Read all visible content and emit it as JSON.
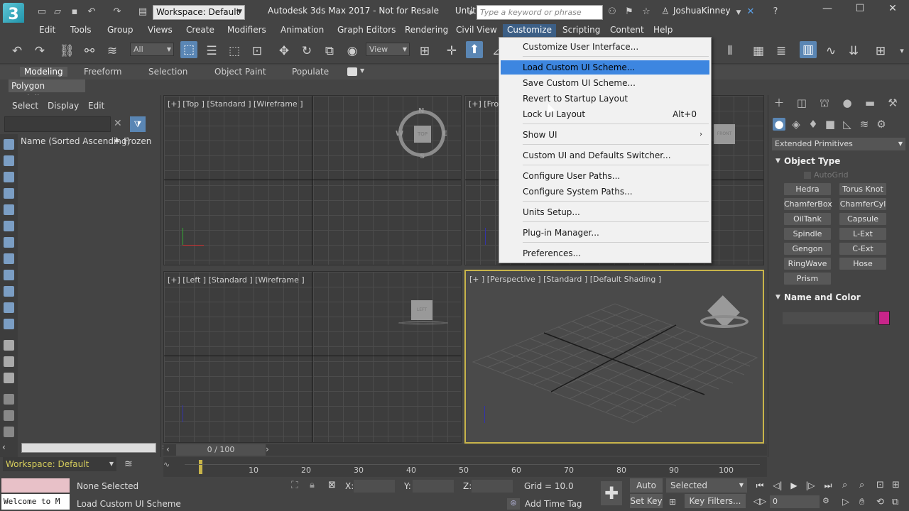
{
  "titlebar": {
    "logo": "3",
    "workspace": "Workspace: Default",
    "title": "Autodesk 3ds Max 2017 - Not for Resale",
    "file": "Untitl...",
    "search_placeholder": "Type a keyword or phrase",
    "user": "JoshuaKinney"
  },
  "menubar": {
    "items": [
      "Edit",
      "Tools",
      "Group",
      "Views",
      "Create",
      "Modifiers",
      "Animation",
      "Graph Editors",
      "Rendering",
      "Civil View",
      "Customize",
      "Scripting",
      "Content",
      "Help"
    ]
  },
  "toolbar": {
    "selection_filter": "All",
    "ref_coord": "View"
  },
  "ribbon": {
    "tabs": [
      "Modeling",
      "Freeform",
      "Selection",
      "Object Paint",
      "Populate"
    ],
    "sub_label": "Polygon Modeling"
  },
  "scene_explorer": {
    "tabs": [
      "Select",
      "Display",
      "Edit"
    ],
    "col_name": "Name (Sorted Ascending)",
    "col_sort": "▲",
    "col_frozen": "Frozen",
    "workspace": "Workspace: Default"
  },
  "viewports": {
    "top": "[+] [Top ] [Standard ] [Wireframe ]",
    "front": "[+] [Fro",
    "left": "[+] [Left ] [Standard ] [Wireframe ]",
    "persp": "[+ ] [Perspective ] [Standard ] [Default Shading ]",
    "cube_top": "TOP",
    "cube_front": "FRONT",
    "cube_left": "LEFT",
    "compass": [
      "N",
      "E",
      "S",
      "W"
    ]
  },
  "customize_menu": {
    "items": [
      {
        "label": "Customize User Interface...",
        "shortcut": ""
      },
      {
        "label": "Load Custom UI Scheme...",
        "shortcut": ""
      },
      {
        "label": "Save Custom UI Scheme...",
        "shortcut": ""
      },
      {
        "label": "Revert to Startup Layout",
        "shortcut": ""
      },
      {
        "label": "Lock UI Layout",
        "shortcut": "Alt+0"
      },
      {
        "label": "Show UI",
        "shortcut": ""
      },
      {
        "label": "Custom UI and Defaults Switcher...",
        "shortcut": ""
      },
      {
        "label": "Configure User Paths...",
        "shortcut": ""
      },
      {
        "label": "Configure System Paths...",
        "shortcut": ""
      },
      {
        "label": "Units Setup...",
        "shortcut": ""
      },
      {
        "label": "Plug-in Manager...",
        "shortcut": ""
      },
      {
        "label": "Preferences...",
        "shortcut": ""
      }
    ]
  },
  "command_panel": {
    "category": "Extended Primitives",
    "object_type_title": "Object Type",
    "autogrid": "AutoGrid",
    "primitives": [
      "Hedra",
      "Torus Knot",
      "ChamferBox",
      "ChamferCyl",
      "OilTank",
      "Capsule",
      "Spindle",
      "L-Ext",
      "Gengon",
      "C-Ext",
      "RingWave",
      "Hose",
      "Prism"
    ],
    "name_color_title": "Name and Color",
    "color": "#c8258a"
  },
  "timeline": {
    "frame": "0 / 100",
    "ticks": [
      "10",
      "20",
      "30",
      "40",
      "50",
      "60",
      "70",
      "80",
      "90",
      "100"
    ]
  },
  "status": {
    "selection": "None Selected",
    "prompt": "Load Custom UI Scheme",
    "maxscript": "Welcome to M",
    "x_label": "X:",
    "y_label": "Y:",
    "z_label": "Z:",
    "grid": "Grid = 10.0",
    "add_time_tag": "Add Time Tag",
    "auto_key": "Auto Key",
    "set_key": "Set Key",
    "selected": "Selected",
    "key_filters": "Key Filters...",
    "frame_field": "0"
  }
}
